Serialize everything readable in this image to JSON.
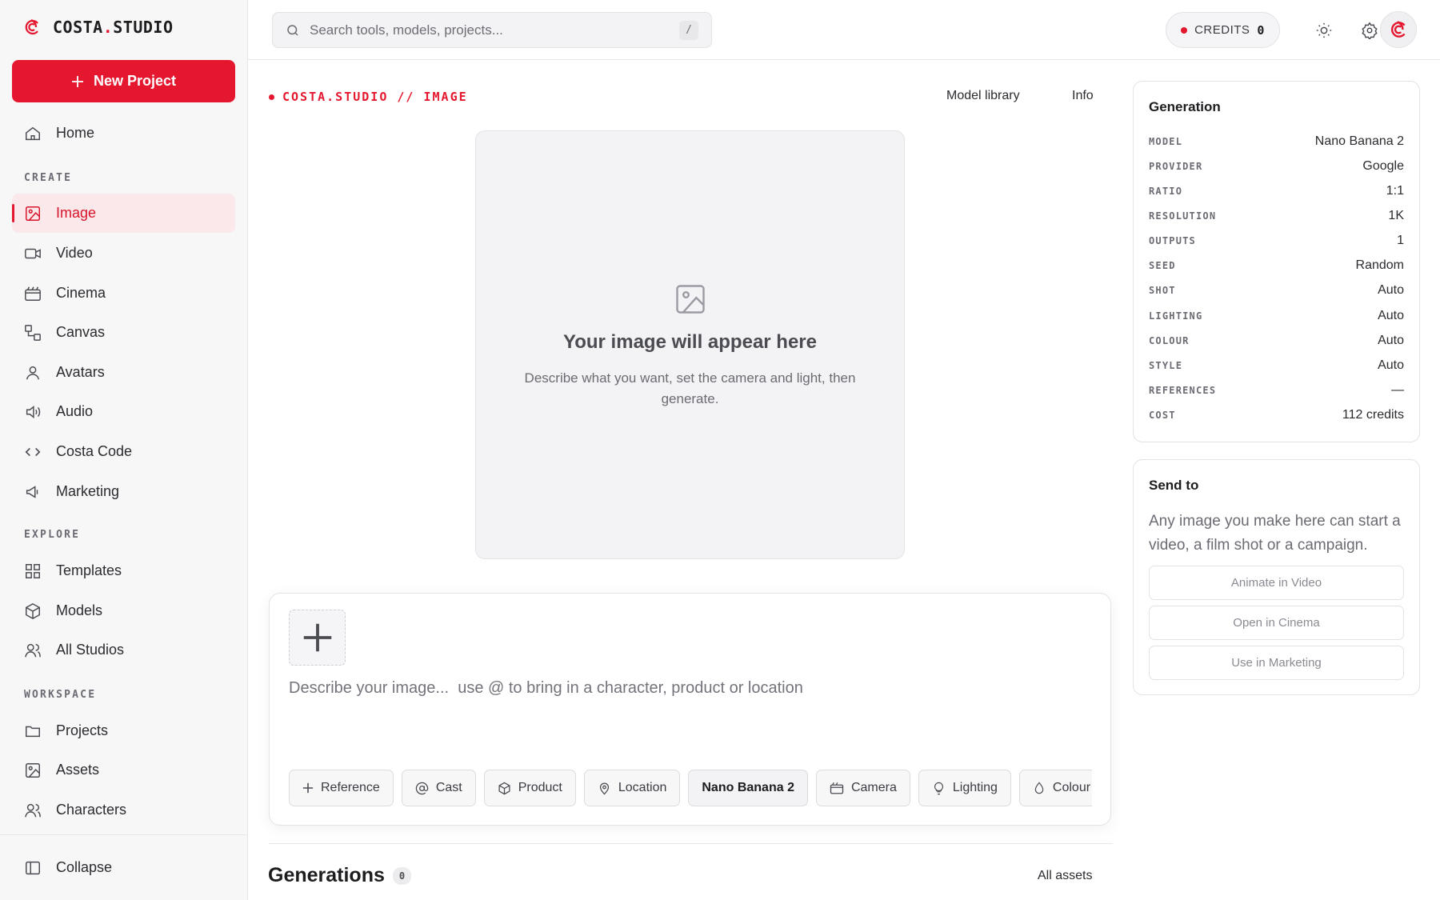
{
  "brand": {
    "name_prefix": "COSTA",
    "name_dot": ".",
    "name_suffix": "STUDIO"
  },
  "sidebar": {
    "new_project_label": "New Project",
    "home_label": "Home",
    "sections": {
      "create": "CREATE",
      "explore": "EXPLORE",
      "workspace": "WORKSPACE"
    },
    "create_items": [
      {
        "label": "Image",
        "icon": "image-icon",
        "active": true
      },
      {
        "label": "Video",
        "icon": "video-icon"
      },
      {
        "label": "Cinema",
        "icon": "clapper-icon"
      },
      {
        "label": "Canvas",
        "icon": "canvas-icon"
      },
      {
        "label": "Avatars",
        "icon": "person-icon"
      },
      {
        "label": "Audio",
        "icon": "speaker-icon"
      },
      {
        "label": "Costa Code",
        "icon": "code-icon"
      },
      {
        "label": "Marketing",
        "icon": "megaphone-icon"
      }
    ],
    "explore_items": [
      {
        "label": "Templates",
        "icon": "grid-icon"
      },
      {
        "label": "Models",
        "icon": "cube-icon"
      },
      {
        "label": "All Studios",
        "icon": "people-icon"
      }
    ],
    "workspace_items": [
      {
        "label": "Projects",
        "icon": "folder-icon"
      },
      {
        "label": "Assets",
        "icon": "image-icon"
      },
      {
        "label": "Characters",
        "icon": "people-icon"
      }
    ],
    "collapse_label": "Collapse"
  },
  "topbar": {
    "search_placeholder": "Search tools, models, projects...",
    "search_shortcut": "/",
    "credits_label": "CREDITS",
    "credits_value": "0"
  },
  "main": {
    "breadcrumb": "COSTA.STUDIO // IMAGE",
    "model_library_label": "Model library",
    "info_label": "Info",
    "preview_title": "Your image will appear here",
    "preview_subtitle": "Describe what you want, set the camera and light, then generate.",
    "prompt_placeholder": "Describe your image...  use @ to bring in a character, product or location",
    "chips": [
      {
        "label": "Reference",
        "icon": "plus-icon"
      },
      {
        "label": "Cast",
        "icon": "at-icon"
      },
      {
        "label": "Product",
        "icon": "box-icon"
      },
      {
        "label": "Location",
        "icon": "pin-icon"
      },
      {
        "label": "Nano Banana 2",
        "icon": ""
      },
      {
        "label": "Camera",
        "icon": "camera-icon"
      },
      {
        "label": "Lighting",
        "icon": "bulb-icon"
      },
      {
        "label": "Colour",
        "icon": "drop-icon"
      }
    ],
    "generations_title": "Generations",
    "generations_count": "0",
    "all_assets_label": "All assets"
  },
  "generation_panel": {
    "title": "Generation",
    "rows": [
      {
        "key": "MODEL",
        "value": "Nano Banana 2"
      },
      {
        "key": "PROVIDER",
        "value": "Google"
      },
      {
        "key": "RATIO",
        "value": "1:1"
      },
      {
        "key": "RESOLUTION",
        "value": "1K"
      },
      {
        "key": "OUTPUTS",
        "value": "1"
      },
      {
        "key": "SEED",
        "value": "Random"
      },
      {
        "key": "SHOT",
        "value": "Auto"
      },
      {
        "key": "LIGHTING",
        "value": "Auto"
      },
      {
        "key": "COLOUR",
        "value": "Auto"
      },
      {
        "key": "STYLE",
        "value": "Auto"
      },
      {
        "key": "REFERENCES",
        "value": "—"
      },
      {
        "key": "COST",
        "value": "112 credits"
      }
    ]
  },
  "send_panel": {
    "title": "Send to",
    "description": "Any image you make here can start a video, a film shot or a campaign.",
    "buttons": [
      "Animate in Video",
      "Open in Cinema",
      "Use in Marketing"
    ]
  },
  "colors": {
    "accent": "#e5172f",
    "accent_soft": "#fbe8ea",
    "sidebar_bg": "#f7f7f8"
  }
}
